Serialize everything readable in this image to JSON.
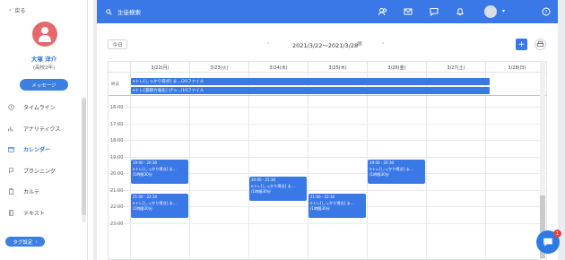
{
  "sidebar": {
    "back_label": "戻る",
    "student_name": "大塚 洋介",
    "student_sub": "(高校3年)",
    "message_button": "メッセージ",
    "nav": [
      {
        "key": "timeline",
        "label": "タイムライン",
        "icon": "clock-icon"
      },
      {
        "key": "analytics",
        "label": "アナリティクス",
        "icon": "analytics-icon"
      },
      {
        "key": "calendar",
        "label": "カレンダー",
        "icon": "calendar-icon",
        "active": true
      },
      {
        "key": "planning",
        "label": "プランニング",
        "icon": "flag-icon"
      },
      {
        "key": "karte",
        "label": "カルテ",
        "icon": "clipboard-icon"
      },
      {
        "key": "text",
        "label": "テキスト",
        "icon": "book-icon"
      }
    ],
    "tag_button": "タグ設定"
  },
  "topbar": {
    "search_placeholder": "生徒検索",
    "icons": [
      "people-icon",
      "mail-icon",
      "chat-icon",
      "bell-icon",
      "avatar",
      "chevron-down-icon",
      "help-icon"
    ],
    "color": "#3b78e7"
  },
  "calendar": {
    "today_label": "今日",
    "range": "2021/3/22〜2021/3/28",
    "allday_label": "終日",
    "days": [
      "3/22(月)",
      "3/23(火)",
      "3/24(水)",
      "3/25(木)",
      "3/26(金)",
      "3/27(土)",
      "3/28(日)"
    ],
    "hours": [
      "16:00",
      "17:00",
      "18:00",
      "19:00",
      "20:00",
      "21:00",
      "22:00",
      "23:00"
    ],
    "allday_events": [
      "eトレ[しっかり得点] ま.../20ファイル",
      "eトレ[基礎力強化] ぴっ.../10ファイル"
    ],
    "events": [
      {
        "time": "19:00 - 20:30",
        "title": "eトレ[しっかり得点] ま...",
        "sub": "/1時間30分"
      },
      {
        "time": "21:00 - 22:30",
        "title": "eトレ[しっかり得点] ま...",
        "sub": "/1時間30分"
      },
      {
        "time": "20:00 - 21:30",
        "title": "eトレ[しっかり得点] ま...",
        "sub": "/1時間30分"
      },
      {
        "time": "21:00 - 22:30",
        "title": "eトレ[しっかり得点] ま...",
        "sub": "/1時間30分"
      },
      {
        "time": "19:00 - 20:30",
        "title": "eトレ[しっかり得点] ま...",
        "sub": "/1時間30分"
      }
    ],
    "event_color": "#3b78e7"
  },
  "chat": {
    "badge": "1"
  }
}
